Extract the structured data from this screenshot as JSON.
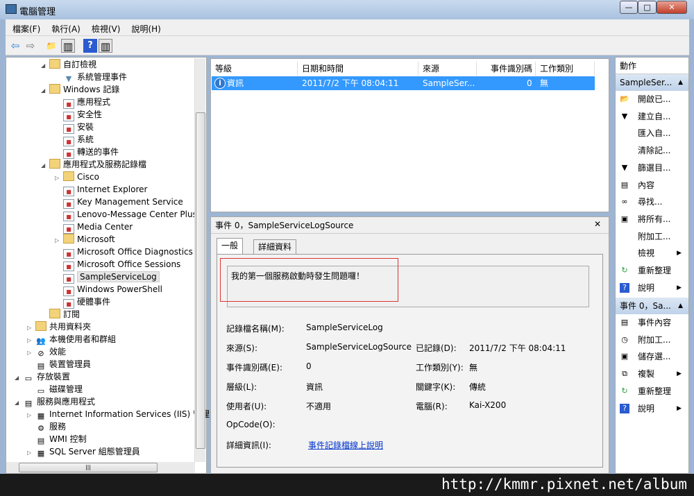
{
  "window": {
    "title": "電腦管理",
    "min": "—",
    "max": "□",
    "close": "✕"
  },
  "menu": [
    "檔案(F)",
    "執行(A)",
    "檢視(V)",
    "說明(H)"
  ],
  "toolbar": {
    "back": "⇦",
    "forward": "⇨",
    "up": "📁",
    "pane": "▥",
    "help": "?",
    "pane2": "▥"
  },
  "tree": [
    {
      "label": "自訂檢視",
      "arrow": "◢",
      "icon": "folder"
    },
    {
      "label": "系統管理事件",
      "arrow": "",
      "icon": "filter"
    },
    {
      "label": "Windows 記錄",
      "arrow": "◢",
      "icon": "folder"
    },
    {
      "label": "應用程式",
      "arrow": "",
      "icon": "log"
    },
    {
      "label": "安全性",
      "arrow": "",
      "icon": "log"
    },
    {
      "label": "安裝",
      "arrow": "",
      "icon": "log"
    },
    {
      "label": "系統",
      "arrow": "",
      "icon": "log"
    },
    {
      "label": "轉送的事件",
      "arrow": "",
      "icon": "log"
    },
    {
      "label": "應用程式及服務記錄檔",
      "arrow": "◢",
      "icon": "folder"
    },
    {
      "label": "Cisco",
      "arrow": "▷",
      "icon": "folder"
    },
    {
      "label": "Internet Explorer",
      "arrow": "",
      "icon": "log"
    },
    {
      "label": "Key Management Service",
      "arrow": "",
      "icon": "log"
    },
    {
      "label": "Lenovo-Message Center Plus/",
      "arrow": "",
      "icon": "log"
    },
    {
      "label": "Media Center",
      "arrow": "",
      "icon": "log"
    },
    {
      "label": "Microsoft",
      "arrow": "▷",
      "icon": "folder"
    },
    {
      "label": "Microsoft Office Diagnostics",
      "arrow": "",
      "icon": "log"
    },
    {
      "label": "Microsoft Office Sessions",
      "arrow": "",
      "icon": "log"
    },
    {
      "label": "SampleServiceLog",
      "arrow": "",
      "icon": "log",
      "selected": true
    },
    {
      "label": "Windows PowerShell",
      "arrow": "",
      "icon": "log"
    },
    {
      "label": "硬體事件",
      "arrow": "",
      "icon": "log"
    },
    {
      "label": "訂閱",
      "arrow": "",
      "icon": "folder"
    },
    {
      "label": "共用資料夾",
      "arrow": "▷",
      "icon": "shared"
    },
    {
      "label": "本機使用者和群組",
      "arrow": "▷",
      "icon": "users"
    },
    {
      "label": "效能",
      "arrow": "▷",
      "icon": "perf"
    },
    {
      "label": "裝置管理員",
      "arrow": "",
      "icon": "device"
    },
    {
      "label": "存放裝置",
      "arrow": "◢",
      "icon": "storage"
    },
    {
      "label": "磁碟管理",
      "arrow": "",
      "icon": "disk"
    },
    {
      "label": "服務與應用程式",
      "arrow": "◢",
      "icon": "services"
    },
    {
      "label": "Internet Information Services (IIS) 管理",
      "arrow": "▷",
      "icon": "iis"
    },
    {
      "label": "服務",
      "arrow": "",
      "icon": "gear"
    },
    {
      "label": "WMI 控制",
      "arrow": "",
      "icon": "wmi"
    },
    {
      "label": "SQL Server 組態管理員",
      "arrow": "▷",
      "icon": "sql"
    }
  ],
  "list": {
    "columns": [
      "等級",
      "日期和時間",
      "來源",
      "事件識別碼",
      "工作類別"
    ],
    "rows": [
      {
        "level": "資訊",
        "datetime": "2011/7/2 下午 08:04:11",
        "source": "SampleSer...",
        "event_id": "0",
        "category": "無"
      }
    ]
  },
  "details": {
    "header": "事件 0，SampleServiceLogSource",
    "close": "✕",
    "tabs": [
      "一般",
      "詳細資料"
    ],
    "message": "我的第一個服務啟動時發生問題囉！",
    "fields": {
      "log_name_label": "記錄檔名稱(M):",
      "log_name": "SampleServiceLog",
      "source_label": "來源(S):",
      "source": "SampleServiceLogSource",
      "logged_label": "已記錄(D):",
      "logged": "2011/7/2 下午 08:04:11",
      "event_id_label": "事件識別碼(E):",
      "event_id": "0",
      "task_label": "工作類別(Y):",
      "task": "無",
      "level_label": "層級(L):",
      "level": "資訊",
      "keywords_label": "關鍵字(K):",
      "keywords": "傳統",
      "user_label": "使用者(U):",
      "user": "不適用",
      "computer_label": "電腦(R):",
      "computer": "Kai-X200",
      "opcode_label": "OpCode(O):",
      "more_label": "詳細資訊(I):",
      "more_link": "事件記錄檔線上說明"
    }
  },
  "actions": {
    "title": "動作",
    "section1": "SampleSer...",
    "items1": [
      {
        "label": "開啟已...",
        "icon": "📂"
      },
      {
        "label": "建立自...",
        "icon": "▼"
      },
      {
        "label": "匯入自...",
        "icon": ""
      },
      {
        "label": "清除記...",
        "icon": ""
      },
      {
        "label": "篩選目...",
        "icon": "▼"
      },
      {
        "label": "內容",
        "icon": "▤"
      },
      {
        "label": "尋找...",
        "icon": "∞"
      },
      {
        "label": "將所有...",
        "icon": "▣"
      },
      {
        "label": "附加工...",
        "icon": ""
      },
      {
        "label": "檢視",
        "icon": "",
        "sub": true
      },
      {
        "label": "重新整理",
        "icon": "↻"
      },
      {
        "label": "說明",
        "icon": "?",
        "sub": true
      }
    ],
    "section2": "事件 0，Sa...",
    "items2": [
      {
        "label": "事件內容",
        "icon": "▤"
      },
      {
        "label": "附加工...",
        "icon": "◷"
      },
      {
        "label": "儲存選...",
        "icon": "▣"
      },
      {
        "label": "複製",
        "icon": "⧉",
        "sub": true
      },
      {
        "label": "重新整理",
        "icon": "↻"
      },
      {
        "label": "說明",
        "icon": "?",
        "sub": true
      }
    ]
  },
  "watermark": "http://kmmr.pixnet.net/album"
}
